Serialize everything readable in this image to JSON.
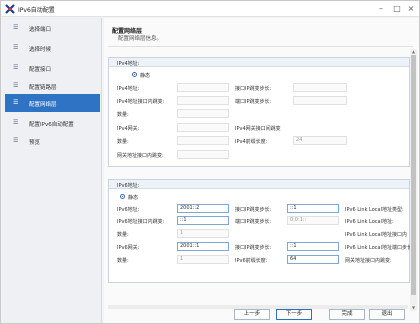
{
  "window": {
    "title": "IPv6自动配置"
  },
  "sidebar": {
    "items": [
      {
        "label": "选择端口"
      },
      {
        "label": "选择时候"
      },
      {
        "label": "配置接口"
      },
      {
        "label": "配置链路层"
      },
      {
        "label": "配置网络层"
      },
      {
        "label": "配置IPv6自动配置"
      },
      {
        "label": "预览"
      }
    ]
  },
  "header": {
    "title": "配置网络层",
    "description": "配置网络层信息。"
  },
  "ipv4": {
    "section_title": "IPv4地址:",
    "radio_label": "静态",
    "address_label": "IPv4地址:",
    "interface_ip_step_label": "接口IP跳变步长:",
    "address_interface_step_label": "IPv4地址接口内跳变:",
    "port_ip_step_label": "端口IP跳变步长:",
    "count_label": "数量:",
    "gateway_label": "IPv4网关:",
    "gateway_step_label": "IPv4网关接口间跳变",
    "count2_label": "数量:",
    "prefix_label": "IPv4前缀长度:",
    "prefix_value": "24",
    "gateway_interface_step_label": "网关地址接口内跳变:"
  },
  "ipv6": {
    "section_title": "IPv6地址:",
    "radio_label": "静态",
    "address_label": "IPv6地址:",
    "address_value": "2001::2",
    "interface_ip_step_label": "接口IP跳变步长:",
    "interface_ip_step_value": "::1",
    "link_local_type_label": "IPv6 Link Local地址类型:",
    "address_interface_step_label": "IPv6地址接口内跳变:",
    "address_interface_step_value": "::1",
    "port_ip_step_label": "端口IP跳变步长:",
    "port_ip_step_value": "0:0:1::",
    "link_local_address_label": "IPv6 Link Local地址:",
    "count_label": "数量:",
    "count_value": "1",
    "link_local_interface_step_label": "IPv6 Link Local地址接口内",
    "gateway_label": "IPv6网关:",
    "gateway_value": "2001::1",
    "gateway_step_label": "接口IP跳变步长:",
    "gateway_step_value": "::1",
    "link_local_port_step_label": "IPv6 Link Local地址端口步长:",
    "count2_label": "数量:",
    "count2_value": "1",
    "prefix_label": "IPv6前缀长度:",
    "prefix_value": "64",
    "gateway_interface_step_label": "网关地址接口内跳变:"
  },
  "footer": {
    "prev_label": "上一步",
    "next_label": "下一步",
    "finish_label": "完成",
    "exit_label": "退出"
  },
  "colors": {
    "accent": "#2f73c4",
    "sidebar_bg": "#eef0f4",
    "panel_head": "#edf2f9"
  }
}
